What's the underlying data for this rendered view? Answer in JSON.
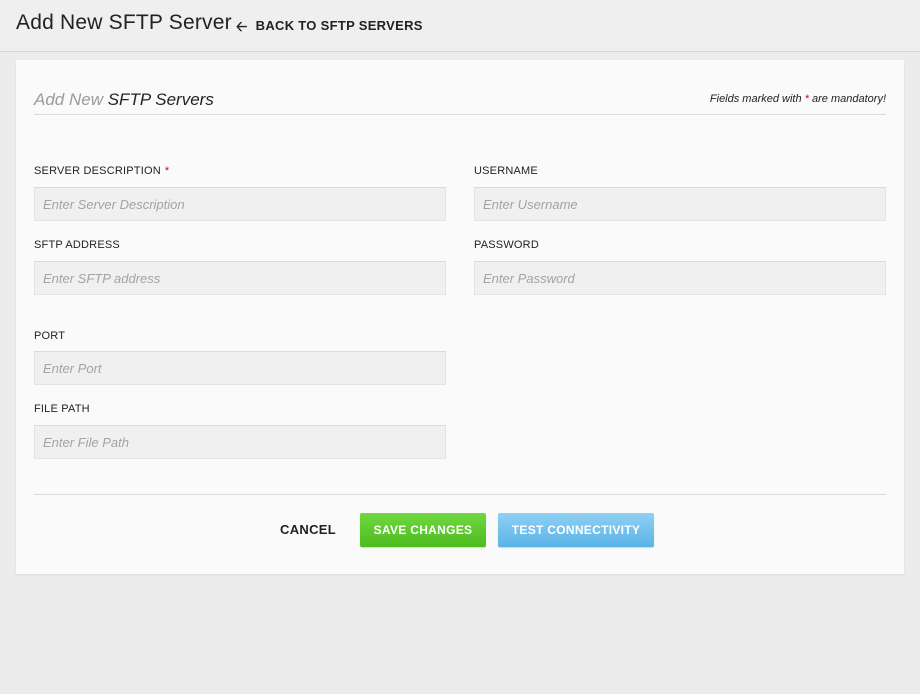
{
  "header": {
    "title": "Add New SFTP Server",
    "back_label": "BACK TO SFTP SERVERS",
    "back_icon": "arrow-left-icon"
  },
  "form": {
    "heading_light": "Add New",
    "heading_dark": "SFTP Servers",
    "mandatory_prefix": "Fields marked with",
    "mandatory_star": "*",
    "mandatory_suffix": "are mandatory!",
    "fields": {
      "server_description": {
        "label": "SERVER DESCRIPTION",
        "required": "*",
        "placeholder": "Enter Server Description",
        "value": ""
      },
      "sftp_address": {
        "label": "SFTP ADDRESS",
        "placeholder": "Enter SFTP address",
        "value": ""
      },
      "port": {
        "label": "PORT",
        "placeholder": "Enter Port",
        "value": ""
      },
      "file_path": {
        "label": "FILE PATH",
        "placeholder": "Enter File Path",
        "value": ""
      },
      "username": {
        "label": "USERNAME",
        "placeholder": "Enter Username",
        "value": ""
      },
      "password": {
        "label": "PASSWORD",
        "placeholder": "Enter Password",
        "value": ""
      }
    }
  },
  "actions": {
    "cancel": "CANCEL",
    "save": "SAVE CHANGES",
    "test": "TEST CONNECTIVITY"
  },
  "colors": {
    "required": "#d0021b",
    "save_button": "#5cc52b",
    "test_button": "#6ec0ec"
  }
}
